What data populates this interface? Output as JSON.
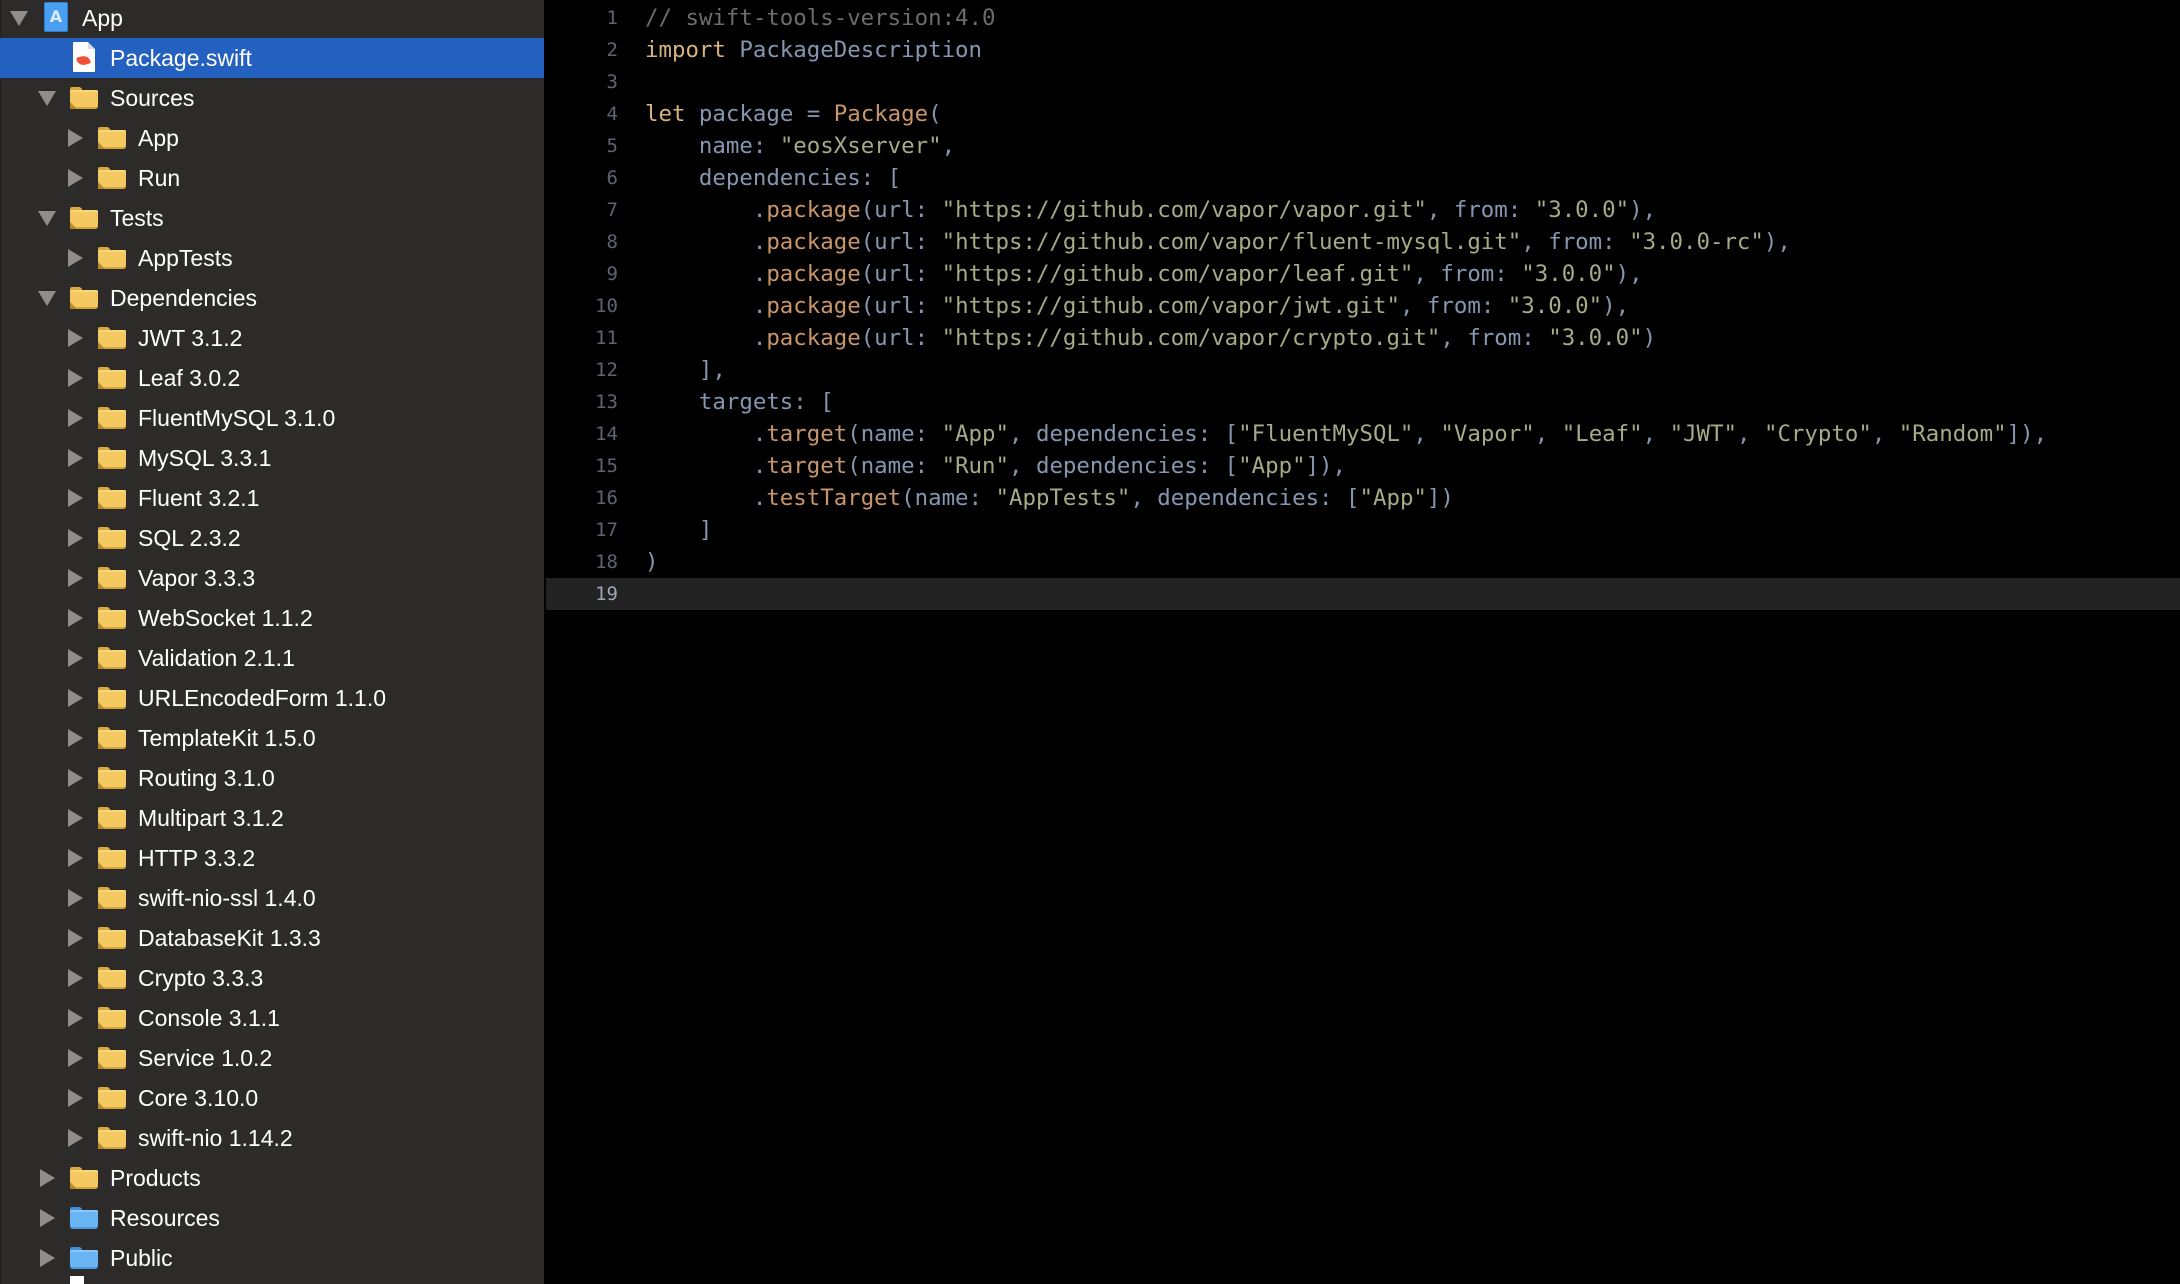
{
  "navigator": {
    "items": [
      {
        "label": "App",
        "level": 0,
        "kind": "project",
        "expanded": true,
        "selected": false
      },
      {
        "label": "Package.swift",
        "level": 1,
        "kind": "swift-file",
        "expanded": null,
        "selected": true
      },
      {
        "label": "Sources",
        "level": 1,
        "kind": "folder",
        "expanded": true,
        "selected": false
      },
      {
        "label": "App",
        "level": 2,
        "kind": "folder",
        "expanded": false,
        "selected": false
      },
      {
        "label": "Run",
        "level": 2,
        "kind": "folder",
        "expanded": false,
        "selected": false
      },
      {
        "label": "Tests",
        "level": 1,
        "kind": "folder",
        "expanded": true,
        "selected": false
      },
      {
        "label": "AppTests",
        "level": 2,
        "kind": "folder",
        "expanded": false,
        "selected": false
      },
      {
        "label": "Dependencies",
        "level": 1,
        "kind": "folder",
        "expanded": true,
        "selected": false
      },
      {
        "label": "JWT 3.1.2",
        "level": 2,
        "kind": "folder",
        "expanded": false,
        "selected": false
      },
      {
        "label": "Leaf 3.0.2",
        "level": 2,
        "kind": "folder",
        "expanded": false,
        "selected": false
      },
      {
        "label": "FluentMySQL 3.1.0",
        "level": 2,
        "kind": "folder",
        "expanded": false,
        "selected": false
      },
      {
        "label": "MySQL 3.3.1",
        "level": 2,
        "kind": "folder",
        "expanded": false,
        "selected": false
      },
      {
        "label": "Fluent 3.2.1",
        "level": 2,
        "kind": "folder",
        "expanded": false,
        "selected": false
      },
      {
        "label": "SQL 2.3.2",
        "level": 2,
        "kind": "folder",
        "expanded": false,
        "selected": false
      },
      {
        "label": "Vapor 3.3.3",
        "level": 2,
        "kind": "folder",
        "expanded": false,
        "selected": false
      },
      {
        "label": "WebSocket 1.1.2",
        "level": 2,
        "kind": "folder",
        "expanded": false,
        "selected": false
      },
      {
        "label": "Validation 2.1.1",
        "level": 2,
        "kind": "folder",
        "expanded": false,
        "selected": false
      },
      {
        "label": "URLEncodedForm 1.1.0",
        "level": 2,
        "kind": "folder",
        "expanded": false,
        "selected": false
      },
      {
        "label": "TemplateKit 1.5.0",
        "level": 2,
        "kind": "folder",
        "expanded": false,
        "selected": false
      },
      {
        "label": "Routing 3.1.0",
        "level": 2,
        "kind": "folder",
        "expanded": false,
        "selected": false
      },
      {
        "label": "Multipart 3.1.2",
        "level": 2,
        "kind": "folder",
        "expanded": false,
        "selected": false
      },
      {
        "label": "HTTP 3.3.2",
        "level": 2,
        "kind": "folder",
        "expanded": false,
        "selected": false
      },
      {
        "label": "swift-nio-ssl 1.4.0",
        "level": 2,
        "kind": "folder",
        "expanded": false,
        "selected": false
      },
      {
        "label": "DatabaseKit 1.3.3",
        "level": 2,
        "kind": "folder",
        "expanded": false,
        "selected": false
      },
      {
        "label": "Crypto 3.3.3",
        "level": 2,
        "kind": "folder",
        "expanded": false,
        "selected": false
      },
      {
        "label": "Console 3.1.1",
        "level": 2,
        "kind": "folder",
        "expanded": false,
        "selected": false
      },
      {
        "label": "Service 1.0.2",
        "level": 2,
        "kind": "folder",
        "expanded": false,
        "selected": false
      },
      {
        "label": "Core 3.10.0",
        "level": 2,
        "kind": "folder",
        "expanded": false,
        "selected": false
      },
      {
        "label": "swift-nio 1.14.2",
        "level": 2,
        "kind": "folder",
        "expanded": false,
        "selected": false
      },
      {
        "label": "Products",
        "level": 1,
        "kind": "folder",
        "expanded": false,
        "selected": false
      },
      {
        "label": "Resources",
        "level": 1,
        "kind": "blue-folder",
        "expanded": false,
        "selected": false
      },
      {
        "label": "Public",
        "level": 1,
        "kind": "blue-folder",
        "expanded": false,
        "selected": false
      }
    ]
  },
  "editor": {
    "file": "Package.swift",
    "current_line": 19,
    "lines": [
      {
        "n": "1",
        "tokens": [
          [
            "comment",
            "// swift-tools-version:4.0"
          ]
        ]
      },
      {
        "n": "2",
        "tokens": [
          [
            "keyword",
            "import"
          ],
          [
            "plain",
            " PackageDescription"
          ]
        ]
      },
      {
        "n": "3",
        "tokens": []
      },
      {
        "n": "4",
        "tokens": [
          [
            "keyword",
            "let"
          ],
          [
            "plain",
            " package = "
          ],
          [
            "type",
            "Package"
          ],
          [
            "punct",
            "("
          ]
        ]
      },
      {
        "n": "5",
        "tokens": [
          [
            "plain",
            "    name: "
          ],
          [
            "string",
            "\"eosXserver\""
          ],
          [
            "punct",
            ","
          ]
        ]
      },
      {
        "n": "6",
        "tokens": [
          [
            "plain",
            "    dependencies: ["
          ]
        ]
      },
      {
        "n": "7",
        "tokens": [
          [
            "plain",
            "        ."
          ],
          [
            "func",
            "package"
          ],
          [
            "punct",
            "(url: "
          ],
          [
            "string",
            "\"https://github.com/vapor/vapor.git\""
          ],
          [
            "punct",
            ", from: "
          ],
          [
            "string",
            "\"3.0.0\""
          ],
          [
            "punct",
            "),"
          ]
        ]
      },
      {
        "n": "8",
        "tokens": [
          [
            "plain",
            "        ."
          ],
          [
            "func",
            "package"
          ],
          [
            "punct",
            "(url: "
          ],
          [
            "string",
            "\"https://github.com/vapor/fluent-mysql.git\""
          ],
          [
            "punct",
            ", from: "
          ],
          [
            "string",
            "\"3.0.0-rc\""
          ],
          [
            "punct",
            "),"
          ]
        ]
      },
      {
        "n": "9",
        "tokens": [
          [
            "plain",
            "        ."
          ],
          [
            "func",
            "package"
          ],
          [
            "punct",
            "(url: "
          ],
          [
            "string",
            "\"https://github.com/vapor/leaf.git\""
          ],
          [
            "punct",
            ", from: "
          ],
          [
            "string",
            "\"3.0.0\""
          ],
          [
            "punct",
            "),"
          ]
        ]
      },
      {
        "n": "10",
        "tokens": [
          [
            "plain",
            "        ."
          ],
          [
            "func",
            "package"
          ],
          [
            "punct",
            "(url: "
          ],
          [
            "string",
            "\"https://github.com/vapor/jwt.git\""
          ],
          [
            "punct",
            ", from: "
          ],
          [
            "string",
            "\"3.0.0\""
          ],
          [
            "punct",
            "),"
          ]
        ]
      },
      {
        "n": "11",
        "tokens": [
          [
            "plain",
            "        ."
          ],
          [
            "func",
            "package"
          ],
          [
            "punct",
            "(url: "
          ],
          [
            "string",
            "\"https://github.com/vapor/crypto.git\""
          ],
          [
            "punct",
            ", from: "
          ],
          [
            "string",
            "\"3.0.0\""
          ],
          [
            "punct",
            ")"
          ]
        ]
      },
      {
        "n": "12",
        "tokens": [
          [
            "plain",
            "    ],"
          ]
        ]
      },
      {
        "n": "13",
        "tokens": [
          [
            "plain",
            "    targets: ["
          ]
        ]
      },
      {
        "n": "14",
        "tokens": [
          [
            "plain",
            "        ."
          ],
          [
            "func",
            "target"
          ],
          [
            "punct",
            "(name: "
          ],
          [
            "string",
            "\"App\""
          ],
          [
            "punct",
            ", dependencies: ["
          ],
          [
            "string",
            "\"FluentMySQL\""
          ],
          [
            "punct",
            ", "
          ],
          [
            "string",
            "\"Vapor\""
          ],
          [
            "punct",
            ", "
          ],
          [
            "string",
            "\"Leaf\""
          ],
          [
            "punct",
            ", "
          ],
          [
            "string",
            "\"JWT\""
          ],
          [
            "punct",
            ", "
          ],
          [
            "string",
            "\"Crypto\""
          ],
          [
            "punct",
            ", "
          ],
          [
            "string",
            "\"Random\""
          ],
          [
            "punct",
            "]),"
          ]
        ]
      },
      {
        "n": "15",
        "tokens": [
          [
            "plain",
            "        ."
          ],
          [
            "func",
            "target"
          ],
          [
            "punct",
            "(name: "
          ],
          [
            "string",
            "\"Run\""
          ],
          [
            "punct",
            ", dependencies: ["
          ],
          [
            "string",
            "\"App\""
          ],
          [
            "punct",
            "]),"
          ]
        ]
      },
      {
        "n": "16",
        "tokens": [
          [
            "plain",
            "        ."
          ],
          [
            "func",
            "testTarget"
          ],
          [
            "punct",
            "(name: "
          ],
          [
            "string",
            "\"AppTests\""
          ],
          [
            "punct",
            ", dependencies: ["
          ],
          [
            "string",
            "\"App\""
          ],
          [
            "punct",
            "])"
          ]
        ]
      },
      {
        "n": "17",
        "tokens": [
          [
            "plain",
            "    ]"
          ]
        ]
      },
      {
        "n": "18",
        "tokens": [
          [
            "punct",
            ")"
          ]
        ]
      },
      {
        "n": "19",
        "tokens": []
      }
    ]
  },
  "colors": {
    "sidebar_bg": "#2c2b2a",
    "selection": "#2360bf",
    "editor_bg": "#000000",
    "current_line_bg": "#232323",
    "keyword": "#d6b37c",
    "string": "#a7aa84",
    "comment": "#6c6c6c",
    "identifier": "#8796b0",
    "function": "#c9956a"
  }
}
